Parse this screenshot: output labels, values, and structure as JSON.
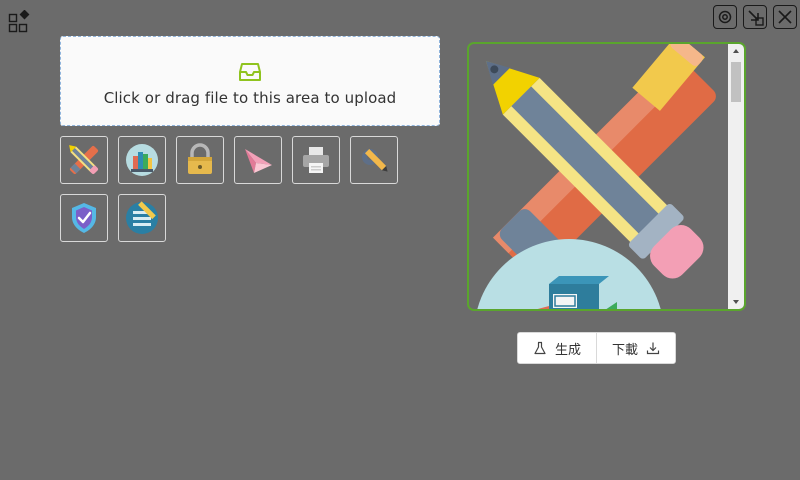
{
  "app": {
    "icon": "apps-grid-icon"
  },
  "window_controls": [
    {
      "name": "settings-icon"
    },
    {
      "name": "minimize-to-corner-icon"
    },
    {
      "name": "close-icon"
    }
  ],
  "upload": {
    "icon": "inbox-icon",
    "text": "Click or drag file to this area to upload",
    "accent_color": "#8fc31f"
  },
  "icon_tiles": [
    {
      "name": "pencil-ruler-tile",
      "icon": "pencil-ruler-icon"
    },
    {
      "name": "books-tile",
      "icon": "books-icon"
    },
    {
      "name": "padlock-tile",
      "icon": "padlock-icon"
    },
    {
      "name": "paper-plane-tile",
      "icon": "paper-plane-icon"
    },
    {
      "name": "printer-tile",
      "icon": "printer-icon"
    },
    {
      "name": "settings-pencil-tile",
      "icon": "settings-pencil-icon"
    },
    {
      "name": "shield-check-tile",
      "icon": "shield-check-icon"
    },
    {
      "name": "checklist-tile",
      "icon": "checklist-icon"
    }
  ],
  "preview": {
    "image": "pencil-ruler-illustration",
    "border_color": "#5aa52d",
    "scroll_position": 0.05
  },
  "actions": {
    "generate_label": "生成",
    "download_label": "下載"
  }
}
